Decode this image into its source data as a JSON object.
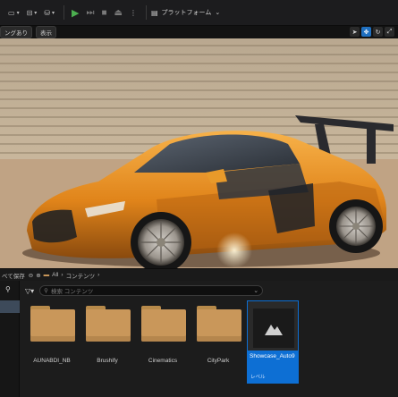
{
  "toolbar": {
    "platform_label": "プラットフォーム",
    "dropdown_arrow": "⌄"
  },
  "viewport_header": {
    "left_pill": "ングあり",
    "view_pill": "表示"
  },
  "content_browser": {
    "save_all_label": "べて保存",
    "breadcrumb_all": "All",
    "breadcrumb_content": "コンテンツ",
    "search_placeholder": "検索 コンテンツ",
    "assets": [
      {
        "name": "AUNABDI_NB",
        "type": "folder"
      },
      {
        "name": "Brushify",
        "type": "folder"
      },
      {
        "name": "Cinematics",
        "type": "folder"
      },
      {
        "name": "CityPark",
        "type": "folder"
      }
    ],
    "selected_asset": {
      "name": "Showcase_Auto9",
      "type_label": "レベル"
    }
  },
  "colors": {
    "accent": "#0d6fd4",
    "folder": "#c9975a",
    "car_orange": "#e08a1a"
  }
}
